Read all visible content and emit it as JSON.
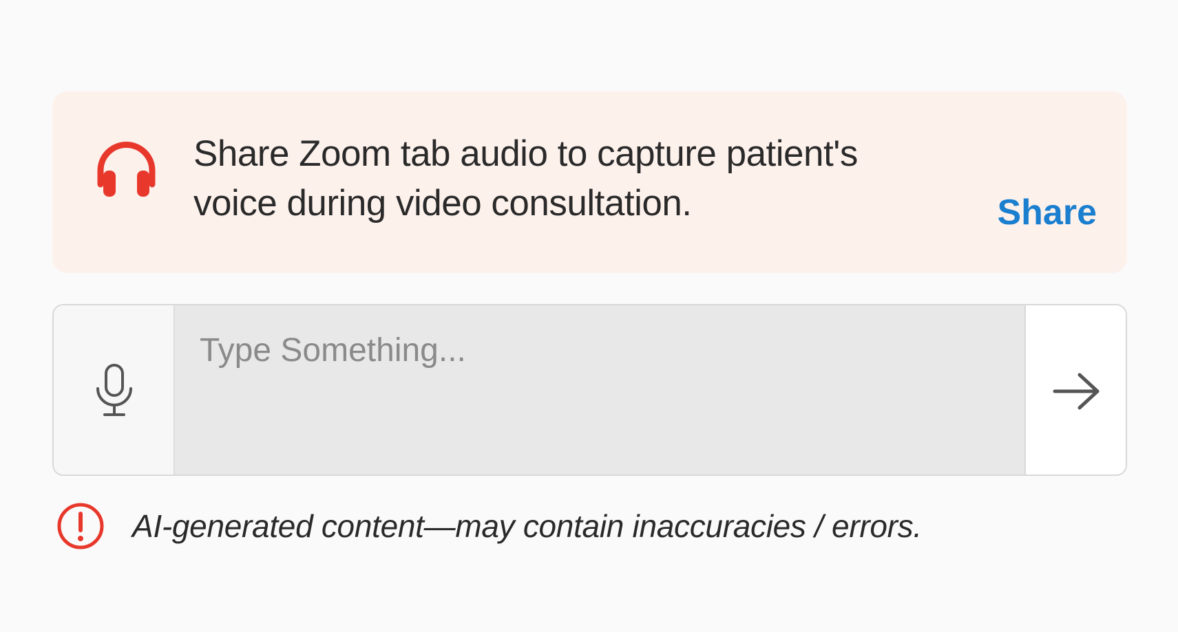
{
  "banner": {
    "icon": "headphones-icon",
    "message": "Share Zoom tab audio to capture patient's voice during video consultation.",
    "action_label": "Share",
    "background": "#fdf1ec",
    "icon_color": "#e8382c",
    "action_color": "#1b7fcf"
  },
  "composer": {
    "mic_icon": "microphone-icon",
    "placeholder": "Type Something...",
    "value": "",
    "send_icon": "arrow-right-icon"
  },
  "disclaimer": {
    "icon": "alert-circle-icon",
    "text": "AI-generated content—may contain inaccuracies / errors.",
    "icon_color": "#e8382c"
  }
}
